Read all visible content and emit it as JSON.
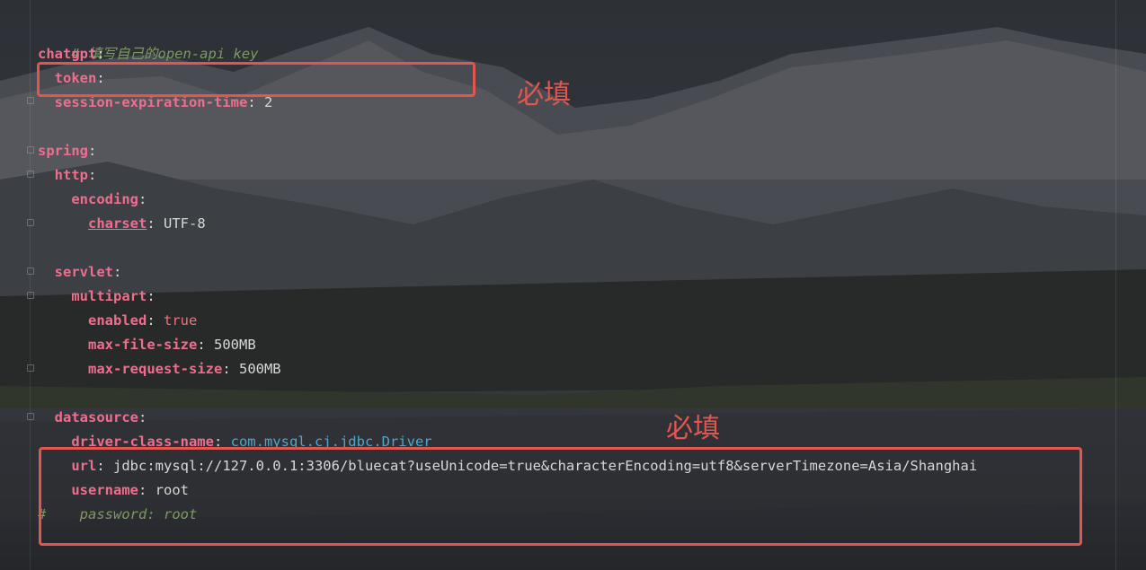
{
  "code": {
    "comment_top": "# 填写自己的open-api key",
    "chatgpt": {
      "key": "chatgpt",
      "colon": ":"
    },
    "token": {
      "key": "token",
      "colon": ":"
    },
    "session": {
      "key": "session-expiration-time",
      "colon": ": ",
      "value": "2"
    },
    "spring": {
      "key": "spring",
      "colon": ":"
    },
    "http": {
      "key": "http",
      "colon": ":"
    },
    "encoding": {
      "key": "encoding",
      "colon": ":"
    },
    "charset": {
      "key": "charset",
      "colon": ": ",
      "value": "UTF-8"
    },
    "servlet": {
      "key": "servlet",
      "colon": ":"
    },
    "multipart": {
      "key": "multipart",
      "colon": ":"
    },
    "enabled": {
      "key": "enabled",
      "colon": ": ",
      "value": "true"
    },
    "max_file_size": {
      "key": "max-file-size",
      "colon": ": ",
      "value": "500MB"
    },
    "max_request_size": {
      "key": "max-request-size",
      "colon": ": ",
      "value": "500MB"
    },
    "datasource": {
      "key": "datasource",
      "colon": ":"
    },
    "driver": {
      "key": "driver-class-name",
      "colon": ": ",
      "value": "com.mysql.cj.jdbc.Driver"
    },
    "url": {
      "key": "url",
      "colon": ": ",
      "value": "jdbc:mysql://127.0.0.1:3306/bluecat?useUnicode=true&characterEncoding=utf8&serverTimezone=Asia/Shanghai"
    },
    "username": {
      "key": "username",
      "colon": ": ",
      "value": "root"
    },
    "password_comment_hash": "#",
    "password_comment_text": "password: root"
  },
  "annotations": {
    "label_1": "必填",
    "label_2": "必填"
  },
  "colors": {
    "key": "#ef6e8e",
    "comment": "#7c9a62",
    "annotation": "#e2564f",
    "class_value": "#4fa7c8"
  }
}
